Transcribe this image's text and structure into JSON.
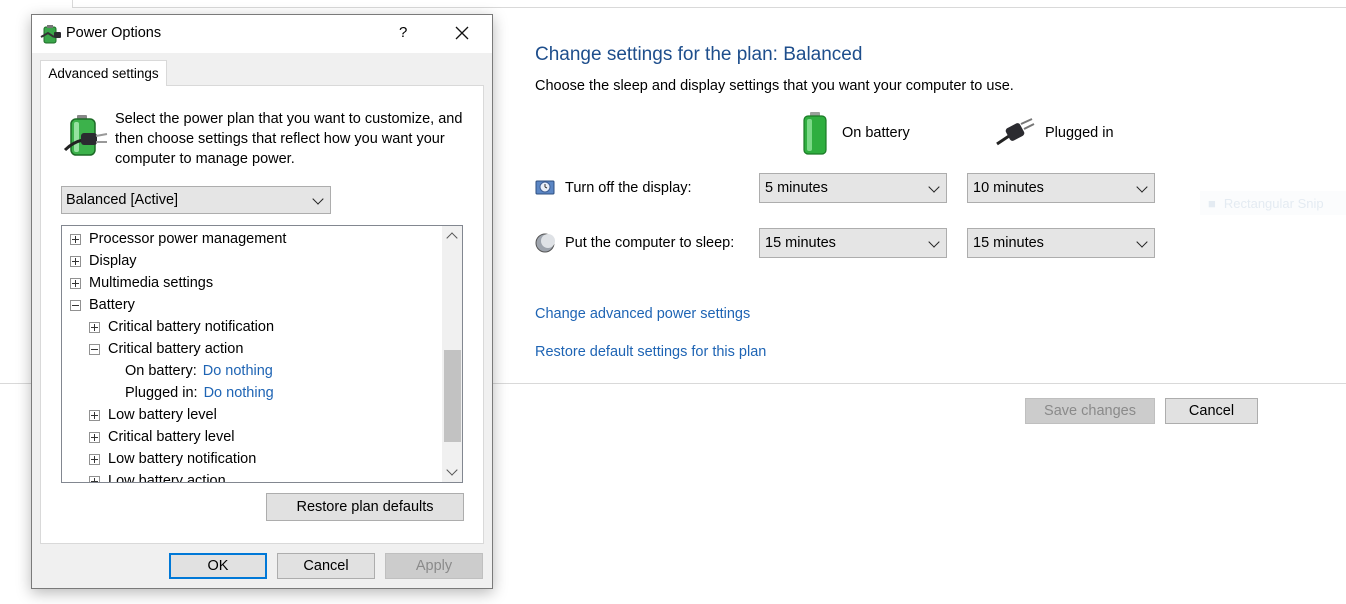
{
  "control_panel": {
    "title": "Change settings for the plan: Balanced",
    "subtitle": "Choose the sleep and display settings that you want your computer to use.",
    "columns": {
      "on_battery": "On battery",
      "plugged_in": "Plugged in"
    },
    "rows": [
      {
        "label": "Turn off the display:",
        "battery_value": "5 minutes",
        "plugged_value": "10 minutes",
        "icon": "display-icon"
      },
      {
        "label": "Put the computer to sleep:",
        "battery_value": "15 minutes",
        "plugged_value": "15 minutes",
        "icon": "moon-icon"
      }
    ],
    "links": {
      "advanced": "Change advanced power settings",
      "restore": "Restore default settings for this plan"
    },
    "buttons": {
      "save": "Save changes",
      "cancel": "Cancel"
    },
    "ghost_text": "Rectangular Snip"
  },
  "dialog": {
    "title": "Power Options",
    "help": "?",
    "tab": "Advanced settings",
    "description": "Select the power plan that you want to customize, and then choose settings that reflect how you want your computer to manage power.",
    "plan_selected": "Balanced [Active]",
    "tree": [
      {
        "label": "Processor power management",
        "state": "collapsed",
        "level": 0
      },
      {
        "label": "Display",
        "state": "collapsed",
        "level": 0
      },
      {
        "label": "Multimedia settings",
        "state": "collapsed",
        "level": 0
      },
      {
        "label": "Battery",
        "state": "expanded",
        "level": 0
      },
      {
        "label": "Critical battery notification",
        "state": "collapsed",
        "level": 1
      },
      {
        "label": "Critical battery action",
        "state": "expanded",
        "level": 1
      },
      {
        "label": "On battery:",
        "value": "Do nothing",
        "level": 2
      },
      {
        "label": "Plugged in:",
        "value": "Do nothing",
        "level": 2
      },
      {
        "label": "Low battery level",
        "state": "collapsed",
        "level": 1
      },
      {
        "label": "Critical battery level",
        "state": "collapsed",
        "level": 1
      },
      {
        "label": "Low battery notification",
        "state": "collapsed",
        "level": 1
      },
      {
        "label": "Low battery action",
        "state": "collapsed",
        "level": 1
      }
    ],
    "buttons": {
      "restore": "Restore plan defaults",
      "ok": "OK",
      "cancel": "Cancel",
      "apply": "Apply"
    }
  },
  "colors": {
    "title_blue": "#1e4e8c",
    "link_blue": "#1e64b4",
    "focus_blue": "#0078d7"
  }
}
